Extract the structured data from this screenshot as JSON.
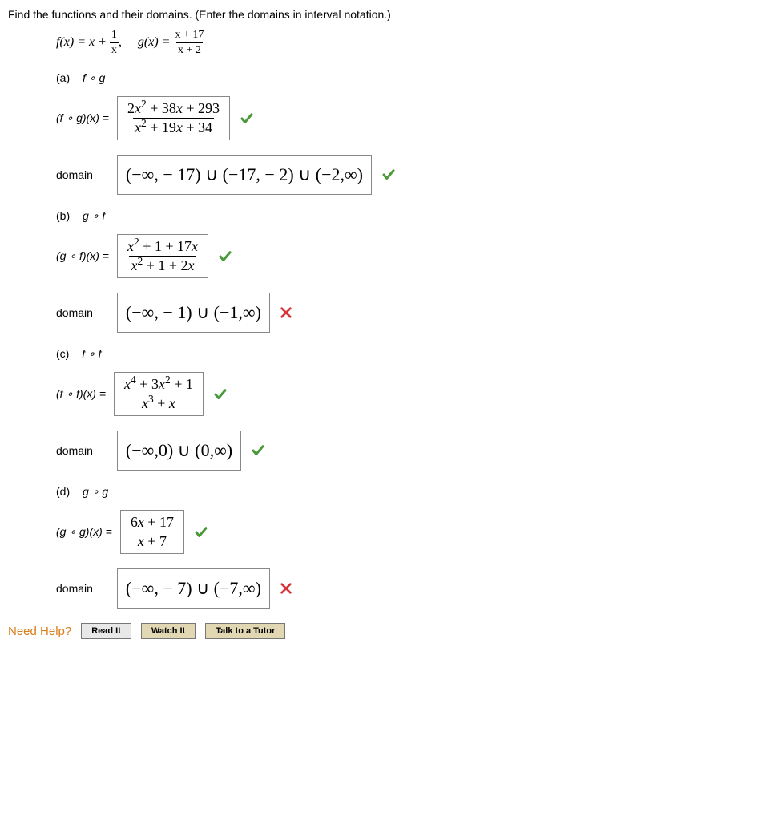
{
  "instructions": "Find the functions and their domains. (Enter the domains in interval notation.)",
  "given": {
    "f_lhs": "f(x) = x + ",
    "f_frac_num": "1",
    "f_frac_den": "x",
    "sep": ",",
    "g_lhs": "g(x) = ",
    "g_frac_num": "x + 17",
    "g_frac_den": "x + 2"
  },
  "parts": {
    "a": {
      "label_pn": "(a)",
      "label_comp": "f ∘ g",
      "fn_lhs": "(f ∘ g)(x) =",
      "fn_num": "2x² + 38x + 293",
      "fn_den": "x² + 19x + 34",
      "fn_correct": true,
      "domain_label": "domain",
      "domain": "(−∞, − 17) ∪ (−17, − 2) ∪ (−2,∞)",
      "domain_correct": true
    },
    "b": {
      "label_pn": "(b)",
      "label_comp": "g ∘ f",
      "fn_lhs": "(g ∘ f)(x) =",
      "fn_num": "x² + 1 + 17x",
      "fn_den": "x² + 1 + 2x",
      "fn_correct": true,
      "domain_label": "domain",
      "domain": "(−∞, − 1) ∪ (−1,∞)",
      "domain_correct": false
    },
    "c": {
      "label_pn": "(c)",
      "label_comp": "f ∘ f",
      "fn_lhs": "(f ∘ f)(x) =",
      "fn_num": "x⁴ + 3x² + 1",
      "fn_den": "x³ + x",
      "fn_correct": true,
      "domain_label": "domain",
      "domain": "(−∞,0) ∪ (0,∞)",
      "domain_correct": true
    },
    "d": {
      "label_pn": "(d)",
      "label_comp": "g ∘ g",
      "fn_lhs": "(g ∘ g)(x) =",
      "fn_num": "6x + 17",
      "fn_den": "x + 7",
      "fn_correct": true,
      "domain_label": "domain",
      "domain": "(−∞, − 7) ∪ (−7,∞)",
      "domain_correct": false
    }
  },
  "help": {
    "label": "Need Help?",
    "read": "Read It",
    "watch": "Watch It",
    "tutor": "Talk to a Tutor"
  }
}
